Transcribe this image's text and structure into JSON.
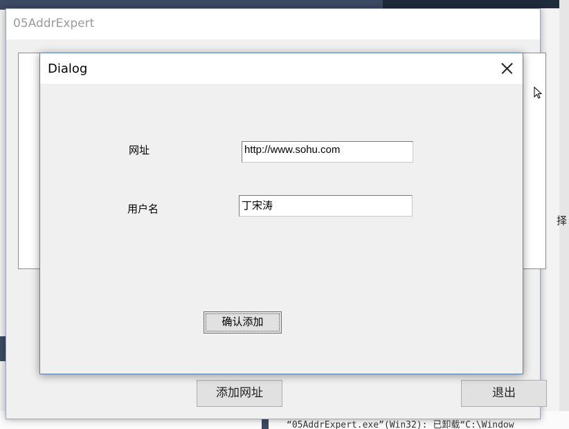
{
  "main_window": {
    "title": "05AddrExpert",
    "add_url_button": "添加网址",
    "exit_button": "退出"
  },
  "dialog": {
    "title": "Dialog",
    "url_label": "网址",
    "url_value": "http://www.sohu.com",
    "username_label": "用户名",
    "username_value": "丁宋涛",
    "confirm_button": "确认添加"
  },
  "background": {
    "output_line": "“05AddrExpert.exe”(Win32): 已卸载“C:\\Window",
    "right_fragment": "择"
  },
  "colors": {
    "dialog_border": "#5b7fae",
    "window_bg": "#f0f0f0",
    "ide_dark": "#3c4a63"
  }
}
